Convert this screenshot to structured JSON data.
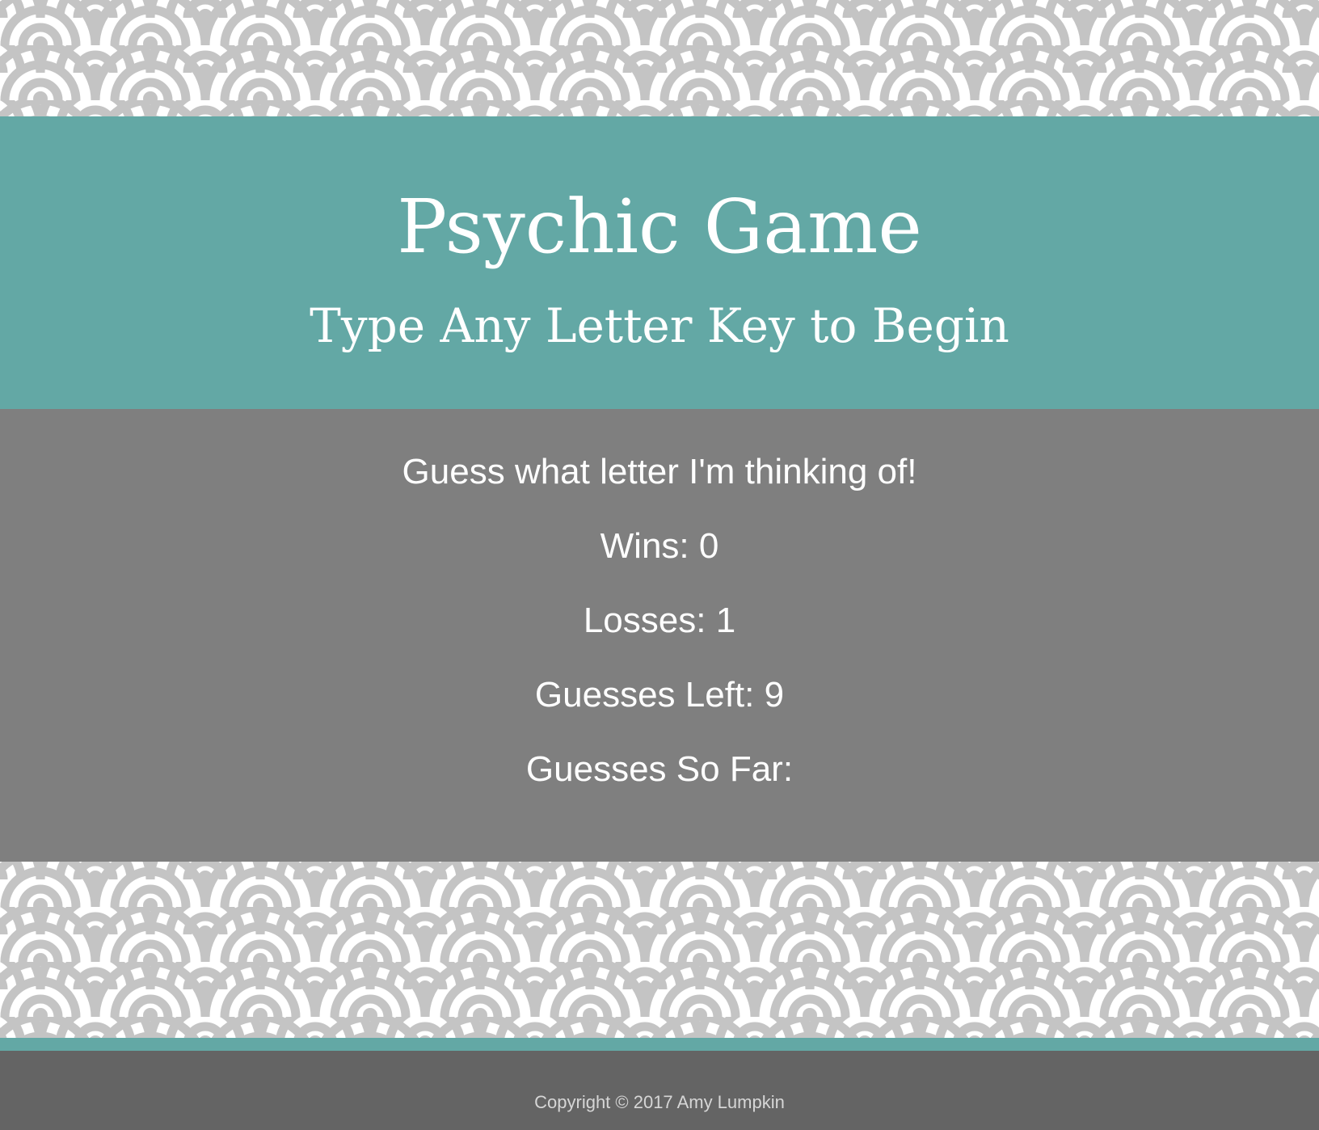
{
  "header": {
    "title": "Psychic Game",
    "subtitle": "Type Any Letter Key to Begin"
  },
  "game": {
    "prompt": "Guess what letter I'm thinking of!",
    "wins": "Wins: 0",
    "losses": "Losses: 1",
    "guesses_left": "Guesses Left: 9",
    "guesses_so_far": "Guesses So Far:"
  },
  "footer": {
    "copyright": "Copyright © 2017 Amy Lumpkin"
  },
  "colors": {
    "teal": "#63a8a5",
    "panel_gray": "#7f7f7f",
    "footer_gray": "#646464",
    "wave_gray": "#c4c4c4",
    "white": "#ffffff"
  },
  "background_pattern": "seigaiha-wave-pattern"
}
